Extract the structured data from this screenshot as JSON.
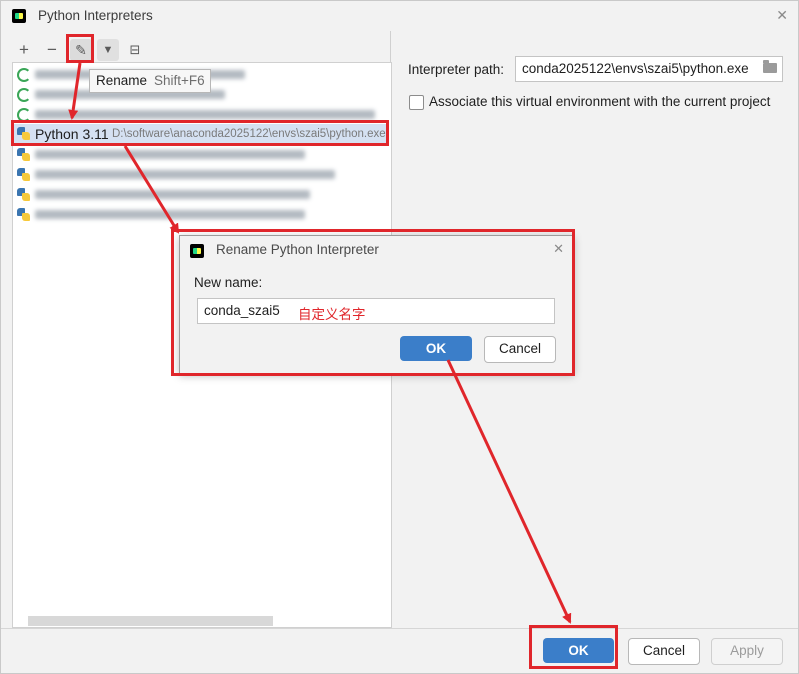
{
  "window": {
    "title": "Python Interpreters",
    "close_icon": "✕"
  },
  "toolbar": {
    "add": "+",
    "remove": "−",
    "rename": "✎",
    "filter": "▼",
    "tree": "⊟"
  },
  "tooltip": {
    "label": "Rename",
    "shortcut": "Shift+F6"
  },
  "interpreters": {
    "selected": {
      "name": "Python 3.11",
      "path": "D:\\software\\anaconda2025122\\envs\\szai5\\python.exe"
    }
  },
  "details": {
    "path_label": "Interpreter path:",
    "path_value": "conda2025122\\envs\\szai5\\python.exe",
    "associate_label": "Associate this virtual environment with the current project"
  },
  "dialog": {
    "title": "Rename Python Interpreter",
    "name_label": "New name:",
    "name_value": "conda_szai5",
    "annotation": "自定义名字",
    "ok": "OK",
    "cancel": "Cancel"
  },
  "buttons": {
    "ok": "OK",
    "cancel": "Cancel",
    "apply": "Apply"
  },
  "colors": {
    "accent": "#3b7ec9",
    "highlight": "#e0262b",
    "selection": "#d5e1f2"
  }
}
